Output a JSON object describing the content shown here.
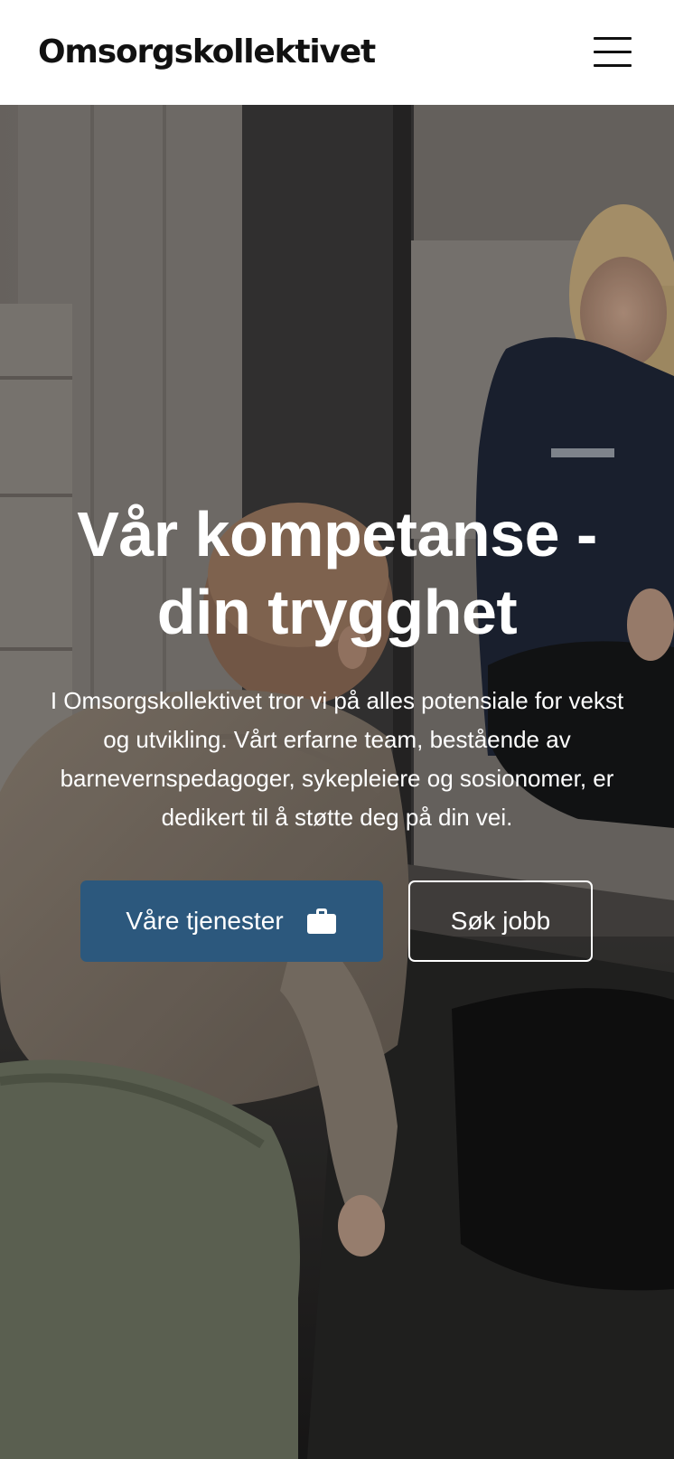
{
  "header": {
    "logo": "Omsorgskollektivet",
    "menu_icon": "hamburger-menu-icon"
  },
  "hero": {
    "background": "photo-woman-and-child-sitting-on-floor",
    "title": "Vår kompetanse - din trygghet",
    "text": "I Omsorgskollektivet tror vi på alles potensiale for vekst og utvikling. Vårt erfarne team, bestående av barnevernspedagoger, sykepleiere og sosionomer, er dedikert til å støtte deg på din vei.",
    "primary_button": {
      "label": "Våre tjenester",
      "icon": "briefcase-icon"
    },
    "secondary_button": {
      "label": "Søk jobb"
    }
  },
  "colors": {
    "primary_button": "#2c587d",
    "header_bg": "#ffffff",
    "text_light": "#ffffff",
    "text_dark": "#111111"
  }
}
